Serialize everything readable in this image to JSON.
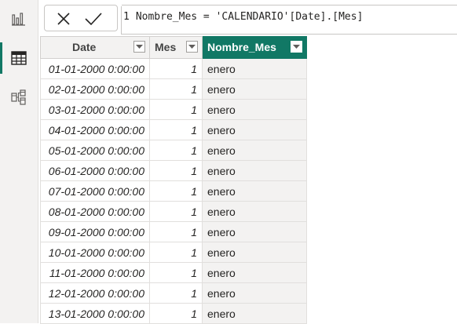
{
  "rail": {
    "items": [
      {
        "icon": "report-view-icon",
        "active": false
      },
      {
        "icon": "table-view-icon",
        "active": true
      },
      {
        "icon": "model-view-icon",
        "active": false
      }
    ]
  },
  "formula_bar": {
    "line_number": "1",
    "expression": "Nombre_Mes = 'CALENDARIO'[Date].[Mes]",
    "cancel_icon": "close-icon",
    "commit_icon": "checkmark-icon"
  },
  "table": {
    "columns": [
      "Date",
      "Mes",
      "Nombre_Mes"
    ],
    "active_column": "Nombre_Mes",
    "rows": [
      {
        "date": "01-01-2000 0:00:00",
        "mes": "1",
        "nombre": "enero"
      },
      {
        "date": "02-01-2000 0:00:00",
        "mes": "1",
        "nombre": "enero"
      },
      {
        "date": "03-01-2000 0:00:00",
        "mes": "1",
        "nombre": "enero"
      },
      {
        "date": "04-01-2000 0:00:00",
        "mes": "1",
        "nombre": "enero"
      },
      {
        "date": "05-01-2000 0:00:00",
        "mes": "1",
        "nombre": "enero"
      },
      {
        "date": "06-01-2000 0:00:00",
        "mes": "1",
        "nombre": "enero"
      },
      {
        "date": "07-01-2000 0:00:00",
        "mes": "1",
        "nombre": "enero"
      },
      {
        "date": "08-01-2000 0:00:00",
        "mes": "1",
        "nombre": "enero"
      },
      {
        "date": "09-01-2000 0:00:00",
        "mes": "1",
        "nombre": "enero"
      },
      {
        "date": "10-01-2000 0:00:00",
        "mes": "1",
        "nombre": "enero"
      },
      {
        "date": "11-01-2000 0:00:00",
        "mes": "1",
        "nombre": "enero"
      },
      {
        "date": "12-01-2000 0:00:00",
        "mes": "1",
        "nombre": "enero"
      },
      {
        "date": "13-01-2000 0:00:00",
        "mes": "1",
        "nombre": "enero"
      }
    ]
  },
  "colors": {
    "accent": "#117865",
    "header_bg": "#f3f2f1",
    "grid_line": "#e1dfdd"
  }
}
